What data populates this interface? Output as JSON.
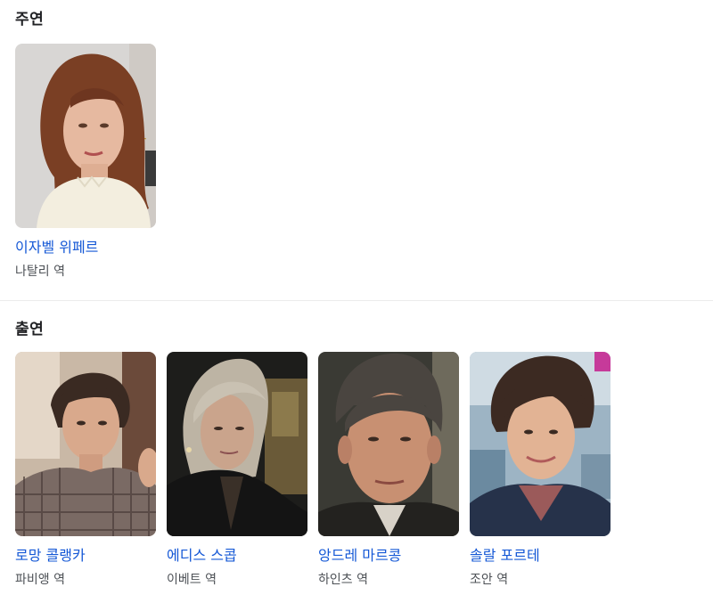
{
  "lead": {
    "title": "주연",
    "cast": [
      {
        "name": "이자벨 위페르",
        "role": "나탈리 역"
      }
    ]
  },
  "supporting": {
    "title": "출연",
    "cast": [
      {
        "name": "로망 콜랭카",
        "role": "파비앵 역"
      },
      {
        "name": "에디스 스콥",
        "role": "이베트 역"
      },
      {
        "name": "앙드레 마르콩",
        "role": "하인츠 역"
      },
      {
        "name": "솔랄 포르테",
        "role": "조안 역"
      }
    ]
  },
  "colors": {
    "link": "#1558d6",
    "title": "#202124",
    "subtext": "#4d5156",
    "divider": "#ebebeb"
  }
}
